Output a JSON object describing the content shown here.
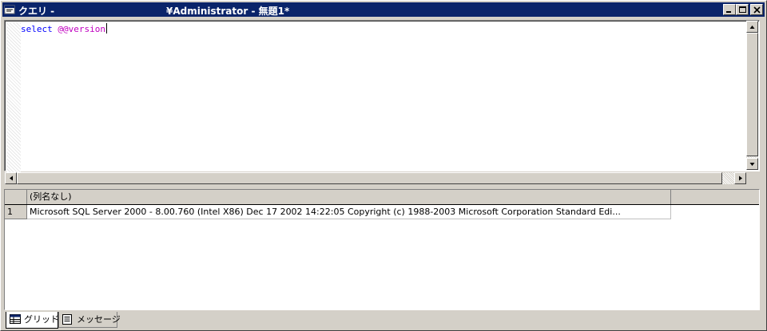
{
  "window": {
    "title_left": "クエリ -",
    "title_center": "¥Administrator - 無題1*"
  },
  "editor": {
    "keyword": "select",
    "variable": "@@version"
  },
  "grid": {
    "columns": [
      "(列名なし)"
    ],
    "rows": [
      {
        "num": "1",
        "value": "Microsoft SQL Server  2000 - 8.00.760 (Intel X86)   Dec 17 2002 14:22:05   Copyright (c) 1988-2003 Microsoft Corporation  Standard Edi..."
      }
    ]
  },
  "tabs": {
    "grid_label": "グリッド",
    "messages_label": "メッセージ"
  },
  "colors": {
    "titlebar": "#0a246a",
    "keyword": "#0000ff",
    "variable": "#c000c0"
  }
}
